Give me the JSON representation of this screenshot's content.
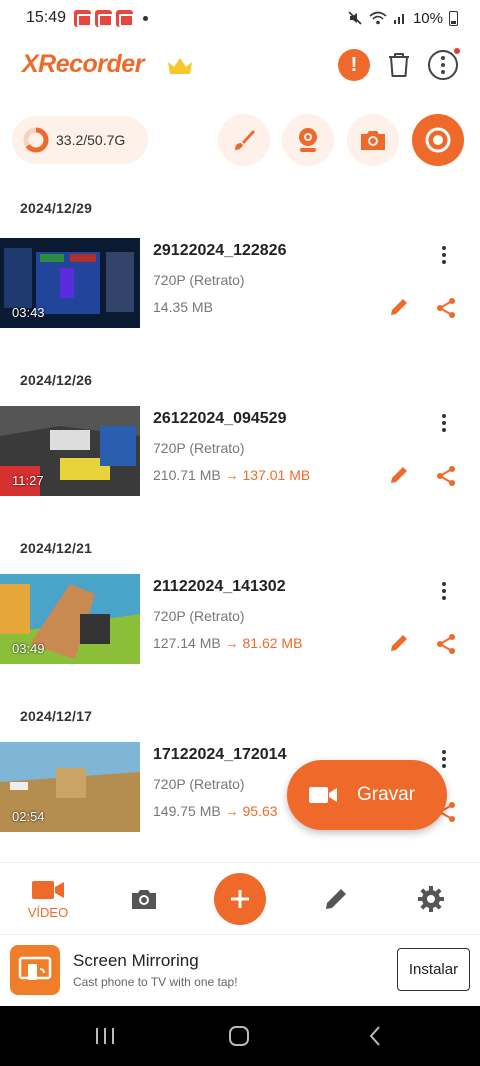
{
  "status_bar": {
    "time": "15:49",
    "battery": "10%"
  },
  "header": {
    "app_name": "XRecorder",
    "icons": [
      "crown-icon",
      "alert-icon",
      "trash-icon",
      "more-options-icon"
    ]
  },
  "storage": {
    "usage": "33.2/50.7G",
    "used_fraction": 0.65
  },
  "toolbar": {
    "icons": [
      "brush-icon",
      "facecam-icon",
      "screenshot-icon",
      "record-icon"
    ]
  },
  "groups": [
    {
      "date": "2024/12/29",
      "item": {
        "title": "29122024_122826",
        "resolution": "720P (Retrato)",
        "size": "14.35 MB",
        "arrow": "",
        "compressed": "",
        "duration": "03:43"
      }
    },
    {
      "date": "2024/12/26",
      "item": {
        "title": "26122024_094529",
        "resolution": "720P (Retrato)",
        "size": "210.71 MB",
        "arrow": "→",
        "compressed": "137.01 MB",
        "duration": "11:27"
      }
    },
    {
      "date": "2024/12/21",
      "item": {
        "title": "21122024_141302",
        "resolution": "720P (Retrato)",
        "size": "127.14 MB",
        "arrow": "→",
        "compressed": "81.62 MB",
        "duration": "03:49"
      }
    },
    {
      "date": "2024/12/17",
      "item": {
        "title": "17122024_172014",
        "resolution": "720P (Retrato)",
        "size": "149.75 MB",
        "arrow": "→",
        "compressed": "95.63",
        "duration": "02:54"
      }
    }
  ],
  "fab": {
    "label": "Gravar"
  },
  "bottom_nav": {
    "video_label": "VÍDEO",
    "active": "video"
  },
  "ad": {
    "title": "Screen Mirroring",
    "subtitle": "Cast phone to TV with one tap!",
    "button": "Instalar"
  },
  "colors": {
    "accent": "#ef6a2a",
    "accent_light": "#fdf1ea"
  }
}
